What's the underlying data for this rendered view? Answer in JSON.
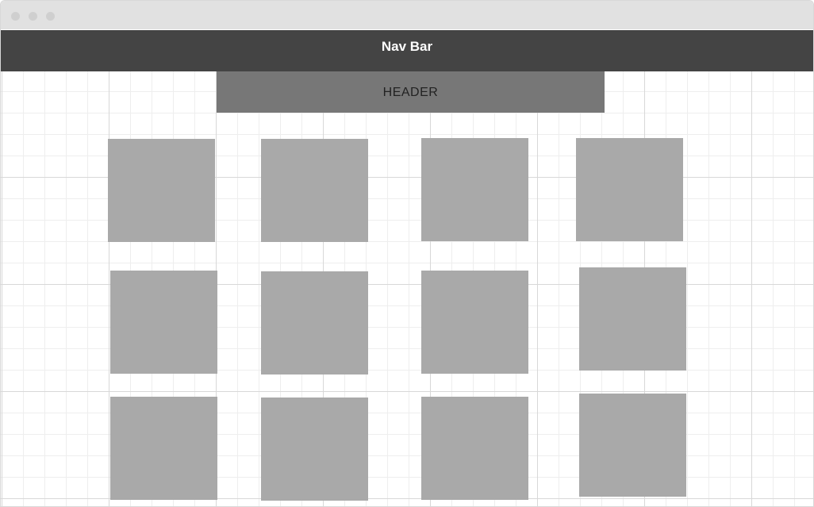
{
  "window": {
    "controls": [
      "close-dot",
      "minimize-dot",
      "maximize-dot"
    ]
  },
  "navbar": {
    "title": "Nav Bar"
  },
  "header": {
    "label": "HEADER"
  },
  "grid": {
    "rows": 3,
    "columns": 4,
    "tiles": [
      {
        "row": 1,
        "col": 1
      },
      {
        "row": 1,
        "col": 2
      },
      {
        "row": 1,
        "col": 3
      },
      {
        "row": 1,
        "col": 4
      },
      {
        "row": 2,
        "col": 1
      },
      {
        "row": 2,
        "col": 2
      },
      {
        "row": 2,
        "col": 3
      },
      {
        "row": 2,
        "col": 4
      },
      {
        "row": 3,
        "col": 1
      },
      {
        "row": 3,
        "col": 2
      },
      {
        "row": 3,
        "col": 3
      },
      {
        "row": 3,
        "col": 4
      }
    ]
  },
  "colors": {
    "navbar": "#444444",
    "header": "#777777",
    "tile": "#a9a9a9",
    "titlebar": "#e1e1e1"
  }
}
